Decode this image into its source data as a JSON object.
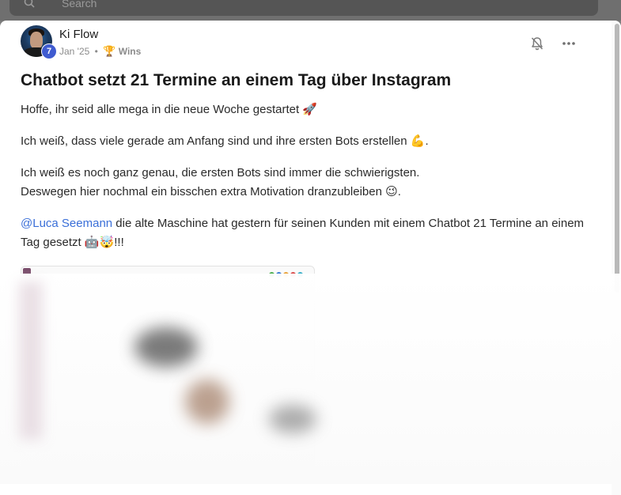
{
  "search": {
    "placeholder": "Search"
  },
  "post": {
    "author": "Ki Flow",
    "level": "7",
    "date": "Jan '25",
    "separator": "•",
    "category_icon": "trophy-icon",
    "category": "Wins",
    "title": "Chatbot setzt 21 Termine an einem Tag über Instagram",
    "paragraphs": {
      "p1": "Hoffe, ihr seid alle mega in die neue Woche gestartet 🚀",
      "p2": "Ich weiß, dass viele gerade am Anfang sind und ihre ersten Bots erstellen 💪.",
      "p3_line1": "Ich weiß es noch ganz genau, die ersten Bots sind immer die schwierigsten.",
      "p3_line2": "Deswegen hier nochmal ein bisschen extra Motivation dranzubleiben 😉.",
      "p4_mention": "@Luca Seemann",
      "p4_rest": " die alte Maschine hat gestern für seinen Kunden mit einem Chatbot 21 Termine an einem Tag gesetzt 🤖🤯!!!"
    }
  },
  "colors": {
    "mention": "#3a6fd8",
    "level_badge": "#3f5bd0"
  },
  "icons": {
    "notification": "bell-off-icon",
    "more": "more-horizontal-icon",
    "search": "search-icon"
  }
}
